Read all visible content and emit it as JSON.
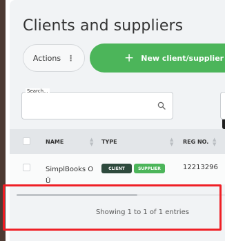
{
  "page": {
    "title": "Clients and suppliers"
  },
  "toolbar": {
    "actions_label": "Actions",
    "actions_icon": "more-vertical-icon",
    "new_label": "New client/supplier",
    "new_icon": "plus-icon"
  },
  "search": {
    "label": "Search...",
    "value": "",
    "icon": "search-icon"
  },
  "table": {
    "columns": [
      "NAME",
      "TYPE",
      "REG NO."
    ],
    "rows": [
      {
        "name": "SimplBooks OÜ",
        "types": [
          "CLIENT",
          "SUPPLIER"
        ],
        "reg_no": "12213296"
      }
    ]
  },
  "footer": {
    "entries_text": "Showing 1 to 1 of 1 entries"
  },
  "colors": {
    "accent_green": "#4cb55a",
    "client_badge": "#2e4a3d",
    "highlight_red": "#ef1f25"
  }
}
